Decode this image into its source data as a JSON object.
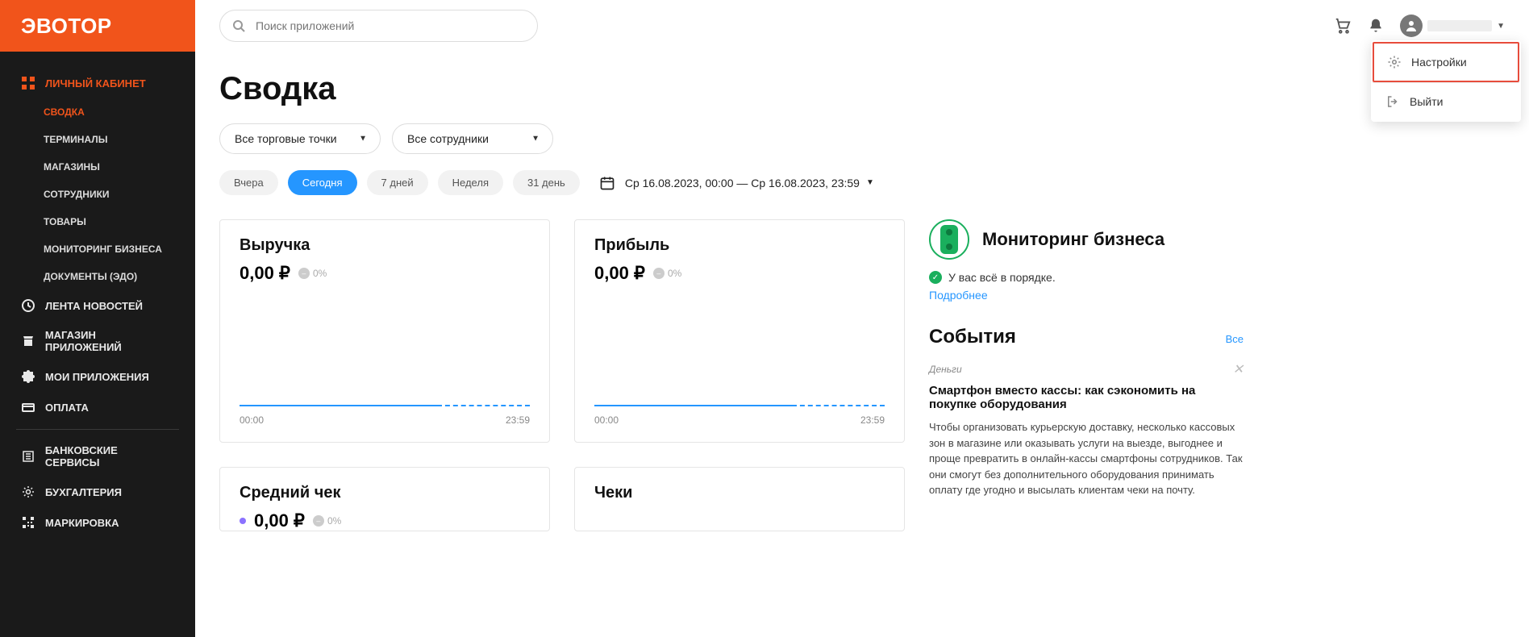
{
  "logo": "ЭВОТОР",
  "search": {
    "placeholder": "Поиск приложений"
  },
  "dropdown": {
    "settings": "Настройки",
    "logout": "Выйти"
  },
  "sidebar": {
    "cabinet": "ЛИЧНЫЙ КАБИНЕТ",
    "subs": [
      {
        "label": "СВОДКА",
        "active": true
      },
      {
        "label": "ТЕРМИНАЛЫ",
        "active": false
      },
      {
        "label": "МАГАЗИНЫ",
        "active": false
      },
      {
        "label": "СОТРУДНИКИ",
        "active": false
      },
      {
        "label": "ТОВАРЫ",
        "active": false
      },
      {
        "label": "МОНИТОРИНГ БИЗНЕСА",
        "active": false
      },
      {
        "label": "ДОКУМЕНТЫ (ЭДО)",
        "active": false
      }
    ],
    "news": "ЛЕНТА НОВОСТЕЙ",
    "store": "МАГАЗИН ПРИЛОЖЕНИЙ",
    "myapps": "МОИ ПРИЛОЖЕНИЯ",
    "payment": "ОПЛАТА",
    "banking": "БАНКОВСКИЕ СЕРВИСЫ",
    "accounting": "БУХГАЛТЕРИЯ",
    "marking": "МАРКИРОВКА"
  },
  "page": {
    "title": "Сводка",
    "filter_points": "Все торговые точки",
    "filter_staff": "Все сотрудники"
  },
  "time": {
    "yesterday": "Вчера",
    "today": "Сегодня",
    "week7": "7 дней",
    "week": "Неделя",
    "day31": "31 день",
    "range": "Ср 16.08.2023, 00:00 — Ср 16.08.2023, 23:59"
  },
  "cards": {
    "revenue": {
      "title": "Выручка",
      "value": "0,00 ₽",
      "pct": "0%",
      "start": "00:00",
      "end": "23:59"
    },
    "profit": {
      "title": "Прибыль",
      "value": "0,00 ₽",
      "pct": "0%",
      "start": "00:00",
      "end": "23:59"
    },
    "avg": {
      "title": "Средний чек",
      "value": "0,00 ₽",
      "pct": "0%"
    },
    "checks": {
      "title": "Чеки"
    }
  },
  "monitoring": {
    "title": "Мониторинг бизнеса",
    "status": "У вас всё в порядке.",
    "more": "Подробнее"
  },
  "events": {
    "title": "События",
    "all": "Все",
    "item": {
      "category": "Деньги",
      "title": "Смартфон вместо кассы: как сэкономить на покупке оборудования",
      "body": "Чтобы организовать курьерскую доставку, несколько кассовых зон в магазине или оказывать услуги на выезде, выгоднее и проще превратить в онлайн-кассы смартфоны сотрудников. Так они смогут без дополнительного оборудования принимать оплату где угодно и высылать клиентам чеки на почту."
    }
  }
}
